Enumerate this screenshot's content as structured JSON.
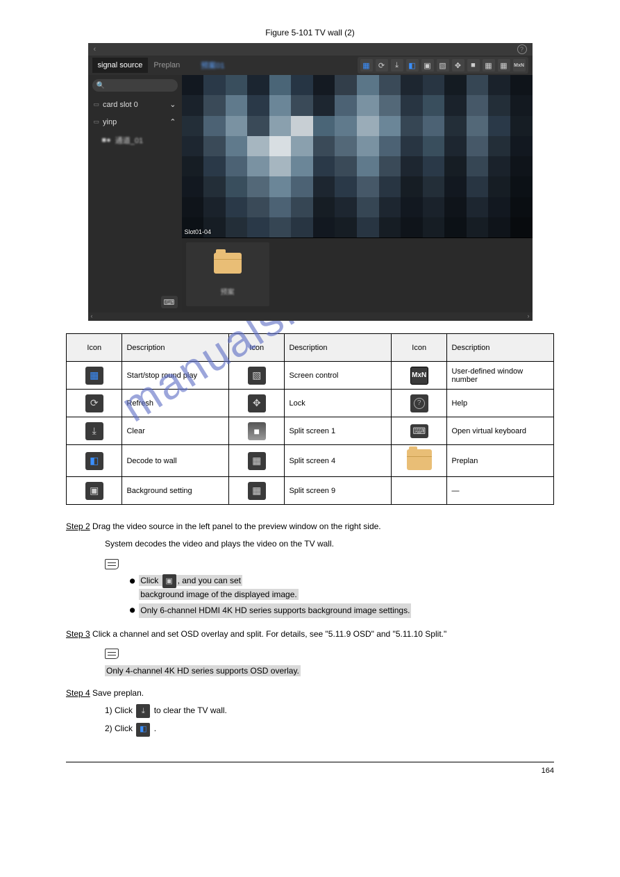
{
  "figure_caption_label": "Figure 5-101",
  "figure_caption_text": "TV wall (2)",
  "app": {
    "tabs": {
      "signal_source": "signal source",
      "preplan": "Preplan",
      "active_plan": "预案01"
    },
    "search_placeholder": "",
    "tree": {
      "card_slot": "card slot 0",
      "yinp": "yinp",
      "camera_blur": "通道_01"
    },
    "video_label": "Slot01-04",
    "preplan_thumb_label": "预案"
  },
  "icons_table": {
    "headers": {
      "icon": "Icon",
      "desc": "Description"
    },
    "rows": [
      {
        "c1_desc": "Start/stop round play",
        "c2_desc": "Screen control",
        "c3_desc": "User-defined window number"
      },
      {
        "c1_desc": "Refresh",
        "c2_desc": "Lock",
        "c3_desc": "Help"
      },
      {
        "c1_desc": "Clear",
        "c2_desc": "Split screen 1",
        "c3_desc": "Open virtual keyboard"
      },
      {
        "c1_desc": "Decode to wall",
        "c2_desc": "Split screen 4",
        "c3_desc": "Preplan"
      },
      {
        "c1_desc": "Background setting",
        "c2_desc": "Split screen 9",
        "c3_desc": "—"
      }
    ]
  },
  "steps": {
    "step2_pre": "Step 2",
    "step2_body": "Drag the video source in the left panel to the preview window on the right side.",
    "step2_body2": "System decodes the video and plays the video on the TV wall.",
    "note_line1_a": "Click",
    "note_line1_b": ", and you can set",
    "note_line2": "background image of the displayed image.",
    "note_line3": "Only 6-channel HDMI 4K HD series supports background image settings.",
    "step3_pre": "Step 3",
    "step3_body": "Click a channel and set OSD overlay and split. For details, see \"5.11.9 OSD\" and \"5.11.10 Split.\"",
    "note_s3": "Only 4-channel 4K HD series supports OSD overlay.",
    "step4_pre": "Step 4",
    "step4_body": " Save preplan.",
    "step4_1": "1) Click",
    "step4_1b": "to clear the TV wall.",
    "step4_2": "2) Click",
    "step4_2b": "."
  },
  "page_number": "164",
  "watermark": "manualshive.com"
}
